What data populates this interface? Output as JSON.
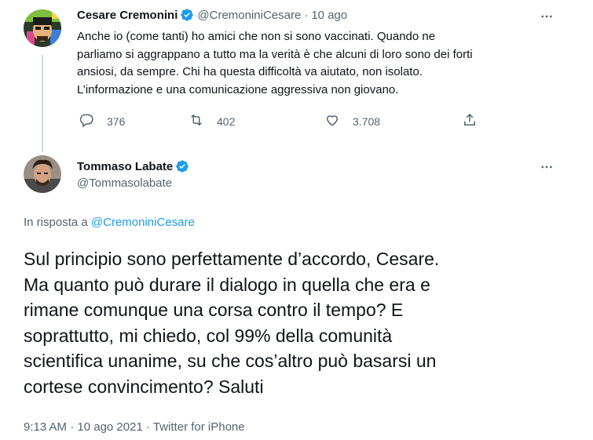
{
  "parent_tweet": {
    "author_name": "Cesare Cremonini",
    "handle": "@CremoniniCesare",
    "separator": "·",
    "time": "10 ago",
    "text_lines": [
      "Anche io (come tanti) ho amici che non si sono vaccinati. Quando ne",
      "parliamo si aggrappano a tutto ma la verità è che alcuni di loro sono dei forti",
      "ansiosi, da sempre. Chi ha questa difficoltà va aiutato, non isolato.",
      "L’informazione e una comunicazione aggressiva non giovano."
    ],
    "actions": {
      "replies": "376",
      "retweets": "402",
      "likes": "3.708"
    }
  },
  "main_tweet": {
    "author_name": "Tommaso Labate",
    "handle": "@Tommasolabate",
    "reply_prefix": "In risposta a",
    "reply_to": "@CremoniniCesare",
    "text_lines": [
      "Sul principio sono perfettamente d’accordo, Cesare.",
      "Ma quanto può durare il dialogo in quella che era e",
      "rimane comunque una corsa contro il tempo? E",
      "soprattutto, mi chiedo, col 99% della comunità",
      "scientifica unanime, su che cos’altro può basarsi un",
      "cortese convincimento? Saluti"
    ],
    "time": "9:13 AM",
    "date": "10 ago 2021",
    "source": "Twitter for iPhone"
  },
  "icons": {
    "verified": "verified-badge-icon",
    "more": "more-icon",
    "reply": "reply-icon",
    "retweet": "retweet-icon",
    "like": "heart-icon",
    "share": "share-icon"
  },
  "colors": {
    "accent": "#1d9bf0",
    "text": "#0f1419",
    "muted": "#536471",
    "thread_line": "#cfd9de"
  }
}
